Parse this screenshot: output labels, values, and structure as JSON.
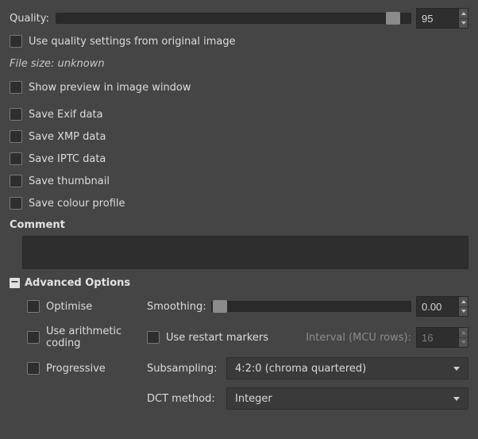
{
  "quality": {
    "label": "Quality:",
    "value": "95",
    "slider_pos": "95%"
  },
  "options": {
    "use_original_quality": "Use quality settings from original image",
    "file_size": "File size: unknown",
    "show_preview": "Show preview in image window",
    "save_exif": "Save Exif data",
    "save_xmp": "Save XMP data",
    "save_iptc": "Save IPTC data",
    "save_thumbnail": "Save thumbnail",
    "save_colour_profile": "Save colour profile"
  },
  "comment": {
    "heading": "Comment",
    "value": ""
  },
  "advanced": {
    "heading": "Advanced Options",
    "optimise": "Optimise",
    "smoothing_label": "Smoothing:",
    "smoothing_value": "0.00",
    "smoothing_pos": "0%",
    "use_arithmetic": "Use arithmetic coding",
    "use_restart": "Use restart markers",
    "interval_label": "Interval (MCU rows):",
    "interval_value": "16",
    "progressive": "Progressive",
    "subsampling_label": "Subsampling:",
    "subsampling_value": "4:2:0 (chroma quartered)",
    "dct_label": "DCT method:",
    "dct_value": "Integer"
  }
}
